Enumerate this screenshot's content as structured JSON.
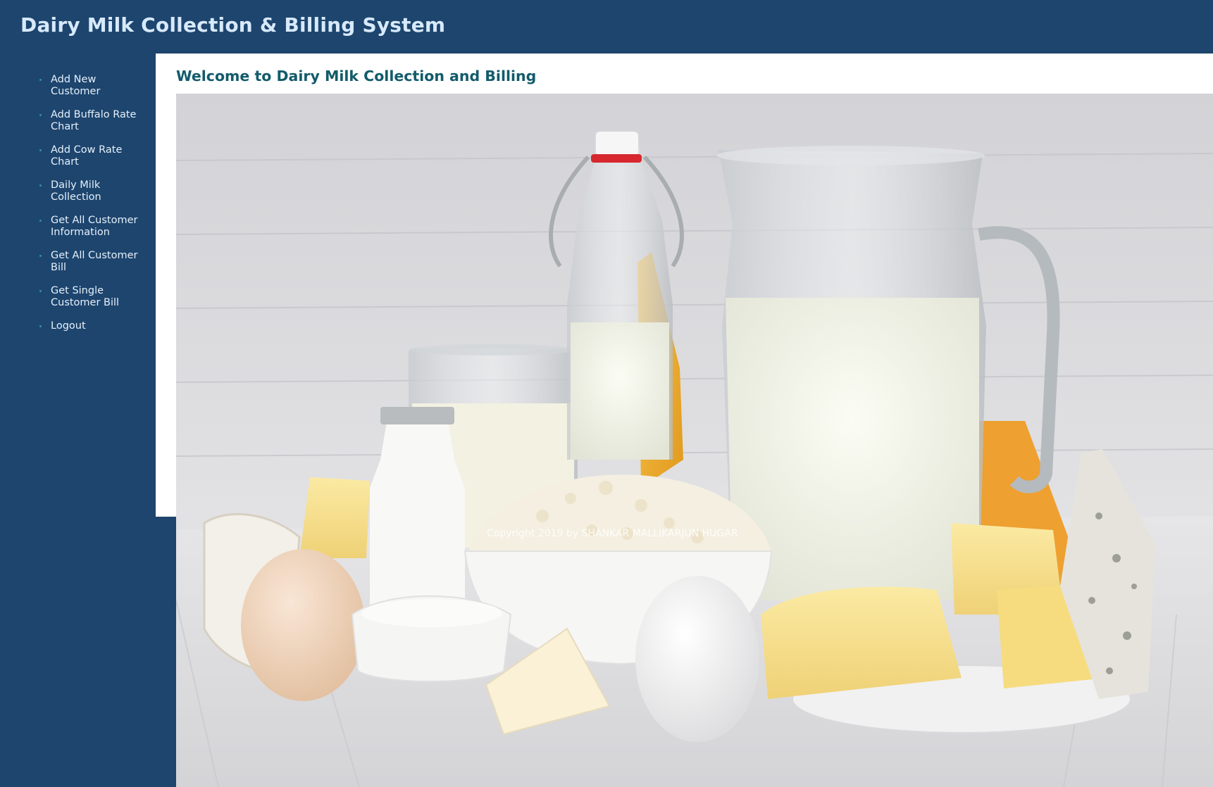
{
  "header": {
    "title": "Dairy Milk Collection & Billing System"
  },
  "sidebar": {
    "items": [
      {
        "label": "Add New Customer"
      },
      {
        "label": "Add Buffalo Rate Chart"
      },
      {
        "label": "Add Cow Rate Chart"
      },
      {
        "label": "Daily Milk Collection"
      },
      {
        "label": "Get All Customer Information"
      },
      {
        "label": "Get All Customer Bill"
      },
      {
        "label": "Get Single Customer Bill"
      },
      {
        "label": "Logout"
      }
    ]
  },
  "main": {
    "heading": "Welcome to Dairy Milk Collection and Billing",
    "hero_image": "dairy-products-photo"
  },
  "footer": {
    "copyright": "Copyright 2019 by SHANKAR MALLIKARJUN HUGAR"
  },
  "colors": {
    "primary": "#1d456e",
    "header_text": "#d7e9fb",
    "heading_text": "#135b6b",
    "panel": "#ffffff"
  }
}
